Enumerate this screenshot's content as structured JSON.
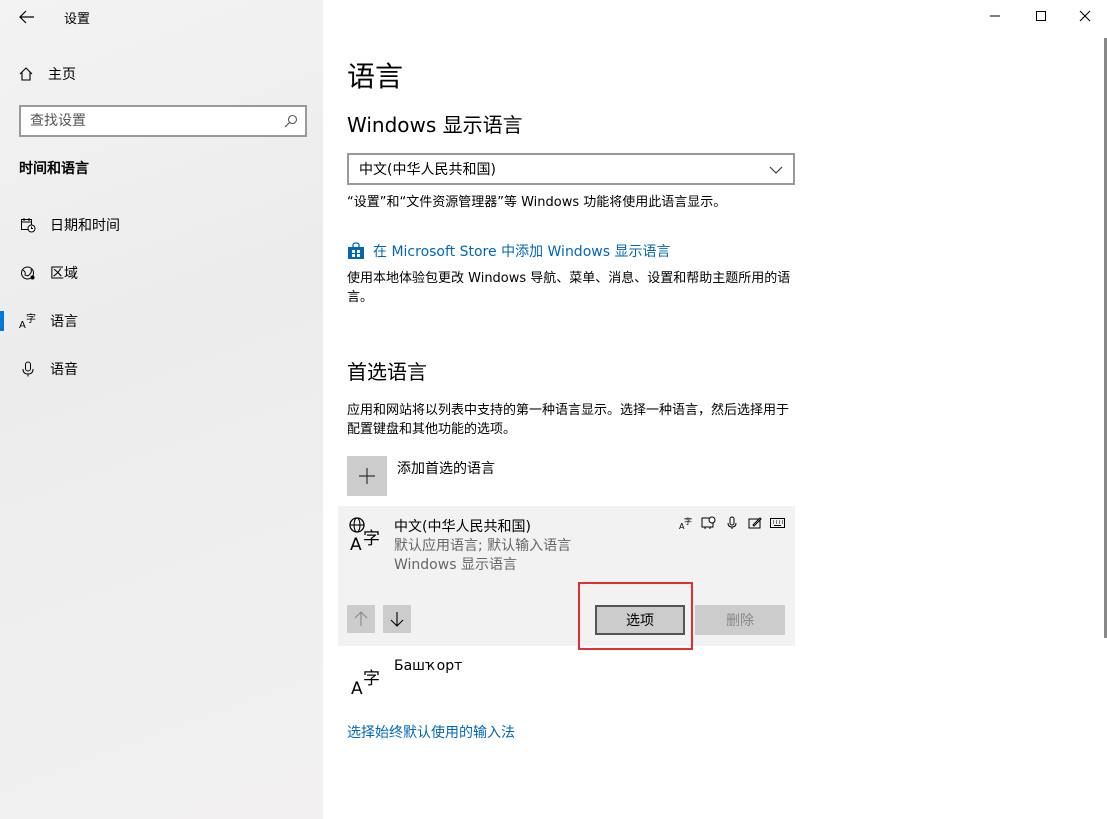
{
  "window": {
    "title": "设置"
  },
  "sidebar": {
    "home_label": "主页",
    "search_placeholder": "查找设置",
    "section_title": "时间和语言",
    "items": [
      {
        "label": "日期和时间",
        "icon": "calendar-clock-icon"
      },
      {
        "label": "区域",
        "icon": "globe-region-icon"
      },
      {
        "label": "语言",
        "icon": "language-icon",
        "active": true
      },
      {
        "label": "语音",
        "icon": "microphone-icon"
      }
    ]
  },
  "main": {
    "title": "语言",
    "display_language": {
      "heading": "Windows 显示语言",
      "selected": "中文(中华人民共和国)",
      "description": "“设置”和“文件资源管理器”等 Windows 功能将使用此语言显示。",
      "store_link": "在 Microsoft Store 中添加 Windows 显示语言",
      "store_description": "使用本地体验包更改 Windows 导航、菜单、消息、设置和帮助主题所用的语言。"
    },
    "preferred": {
      "heading": "首选语言",
      "description": "应用和网站将以列表中支持的第一种语言显示。选择一种语言，然后选择用于配置键盘和其他功能的选项。",
      "add_label": "添加首选的语言",
      "languages": [
        {
          "name": "中文(中华人民共和国)",
          "line1": "默认应用语言; 默认输入语言",
          "line2": "Windows 显示语言",
          "options_label": "选项",
          "remove_label": "删除"
        },
        {
          "name": "Башҡорт"
        }
      ]
    },
    "bottom_link": "选择始终默认使用的输入法"
  },
  "colors": {
    "accent": "#0078d7",
    "link": "#0067b8",
    "highlight": "#e03030"
  }
}
